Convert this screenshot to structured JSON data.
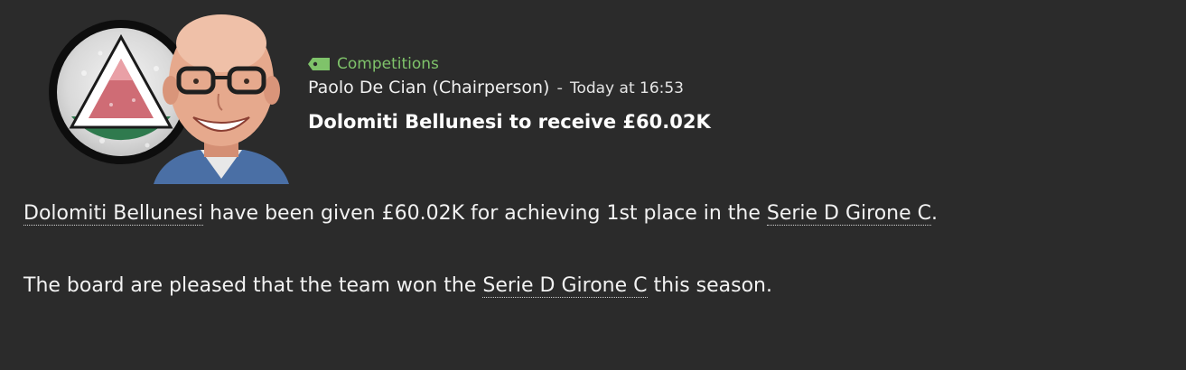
{
  "header": {
    "category": {
      "icon": "tag-icon",
      "label": "Competitions",
      "color": "#7fc36a"
    },
    "sender": "Paolo De Cian (Chairperson)",
    "separator": "-",
    "timestamp": "Today at 16:53",
    "headline": "Dolomiti Bellunesi to receive £60.02K"
  },
  "body": {
    "paragraph1": {
      "club_link": "Dolomiti Bellunesi",
      "text_a": " have been given £60.02K for achieving 1st place in the ",
      "competition_link": "Serie D Girone C",
      "text_b": "."
    },
    "paragraph2": {
      "text_a": "The board are pleased that the team won the ",
      "competition_link": "Serie D Girone C",
      "text_b": " this season."
    }
  },
  "colors": {
    "background": "#2b2b2b",
    "accent_green": "#7fc36a",
    "text": "#f2f2f2"
  }
}
